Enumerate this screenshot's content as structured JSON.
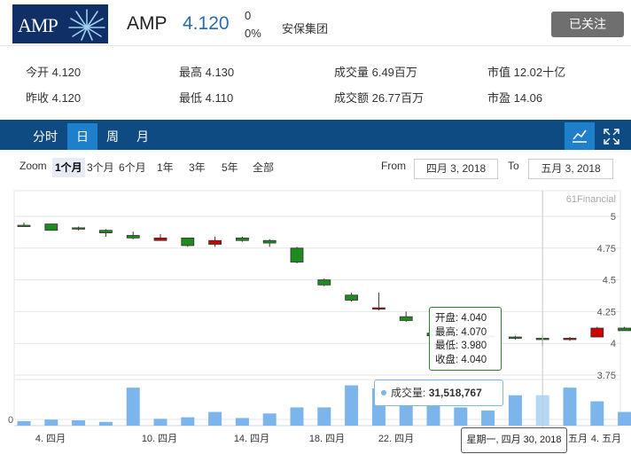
{
  "header": {
    "logo_text": "AMP",
    "ticker": "AMP",
    "price": "4.120",
    "change": "0",
    "change_pct": "0%",
    "name": "安保集团",
    "follow_label": "已关注"
  },
  "stats": {
    "open": "今开 4.120",
    "high": "最高 4.130",
    "volume": "成交量 6.49百万",
    "mcap": "市值 12.02十亿",
    "prev": "昨收 4.120",
    "low": "最低 4.110",
    "turnover": "成交额 26.77百万",
    "pe": "市盈 14.06"
  },
  "tabs": [
    {
      "label": "分时",
      "selected": false
    },
    {
      "label": "日",
      "selected": true
    },
    {
      "label": "周",
      "selected": false
    },
    {
      "label": "月",
      "selected": false
    }
  ],
  "toolbar_icons": [
    "line-chart-icon",
    "fullscreen-icon"
  ],
  "range": {
    "zoom_label": "Zoom",
    "buttons": [
      {
        "label": "1个月",
        "selected": true
      },
      {
        "label": "3个月",
        "selected": false
      },
      {
        "label": "6个月",
        "selected": false
      },
      {
        "label": "1年",
        "selected": false
      },
      {
        "label": "3年",
        "selected": false
      },
      {
        "label": "5年",
        "selected": false
      },
      {
        "label": "全部",
        "selected": false
      }
    ],
    "from_label": "From",
    "from_value": "四月 3, 2018",
    "to_label": "To",
    "to_value": "五月 3, 2018"
  },
  "chart_data": {
    "type": "candlestick",
    "credit": "61Financial",
    "colors": {
      "up": "#cc0000",
      "down": "#1f8a1f",
      "volume": "#7cb5ec",
      "volume_highlight": "#b5d8f7"
    },
    "yticks": [
      "5",
      "4.75",
      "4.5",
      "4.25",
      "4",
      "3.75"
    ],
    "ylim": [
      3.75,
      5.1
    ],
    "vol_tick": "0",
    "xlabels": [
      "4. 四月",
      "10. 四月",
      "14. 四月",
      "18. 四月",
      "22. 四月",
      "五月",
      "4. 五月"
    ],
    "candles": [
      {
        "o": 4.93,
        "h": 4.95,
        "l": 4.92,
        "c": 4.92
      },
      {
        "o": 4.94,
        "h": 4.94,
        "l": 4.89,
        "c": 4.89
      },
      {
        "o": 4.91,
        "h": 4.92,
        "l": 4.89,
        "c": 4.9
      },
      {
        "o": 4.89,
        "h": 4.9,
        "l": 4.84,
        "c": 4.87
      },
      {
        "o": 4.85,
        "h": 4.88,
        "l": 4.82,
        "c": 4.83
      },
      {
        "o": 4.81,
        "h": 4.86,
        "l": 4.81,
        "c": 4.83
      },
      {
        "o": 4.83,
        "h": 4.83,
        "l": 4.76,
        "c": 4.77
      },
      {
        "o": 4.78,
        "h": 4.84,
        "l": 4.76,
        "c": 4.81
      },
      {
        "o": 4.83,
        "h": 4.84,
        "l": 4.8,
        "c": 4.81
      },
      {
        "o": 4.81,
        "h": 4.82,
        "l": 4.76,
        "c": 4.79
      },
      {
        "o": 4.75,
        "h": 4.76,
        "l": 4.63,
        "c": 4.64
      },
      {
        "o": 4.5,
        "h": 4.51,
        "l": 4.45,
        "c": 4.46
      },
      {
        "o": 4.38,
        "h": 4.4,
        "l": 4.33,
        "c": 4.34
      },
      {
        "o": 4.27,
        "h": 4.4,
        "l": 4.26,
        "c": 4.28
      },
      {
        "o": 4.21,
        "h": 4.25,
        "l": 4.17,
        "c": 4.18
      },
      {
        "o": 4.08,
        "h": 4.12,
        "l": 4.05,
        "c": 4.06
      },
      {
        "o": 4.07,
        "h": 4.09,
        "l": 4.03,
        "c": 4.05
      },
      {
        "o": 4.06,
        "h": 4.08,
        "l": 4.04,
        "c": 4.05
      },
      {
        "o": 4.05,
        "h": 4.06,
        "l": 4.03,
        "c": 4.04
      },
      {
        "o": 4.04,
        "h": 4.07,
        "l": 3.98,
        "c": 4.04
      },
      {
        "o": 4.03,
        "h": 4.05,
        "l": 4.02,
        "c": 4.04
      },
      {
        "o": 4.05,
        "h": 4.13,
        "l": 4.05,
        "c": 4.12
      },
      {
        "o": 4.12,
        "h": 4.13,
        "l": 4.11,
        "c": 4.1
      }
    ],
    "volumes": [
      0.3,
      0.4,
      0.35,
      0.25,
      2.5,
      0.45,
      0.55,
      0.9,
      0.5,
      0.8,
      1.2,
      1.2,
      2.65,
      2.45,
      2.3,
      2.3,
      1.2,
      1.0,
      2.0,
      2.0,
      2.5,
      1.6,
      0.9
    ],
    "hover_index": 19,
    "tooltip": {
      "open": "开盘: 4.040",
      "high": "最高: 4.070",
      "low": "最低: 3.980",
      "close": "收盘: 4.040",
      "volume_label": "成交量:",
      "volume_value": "31,518,767",
      "date": "星期一, 四月 30, 2018"
    }
  }
}
